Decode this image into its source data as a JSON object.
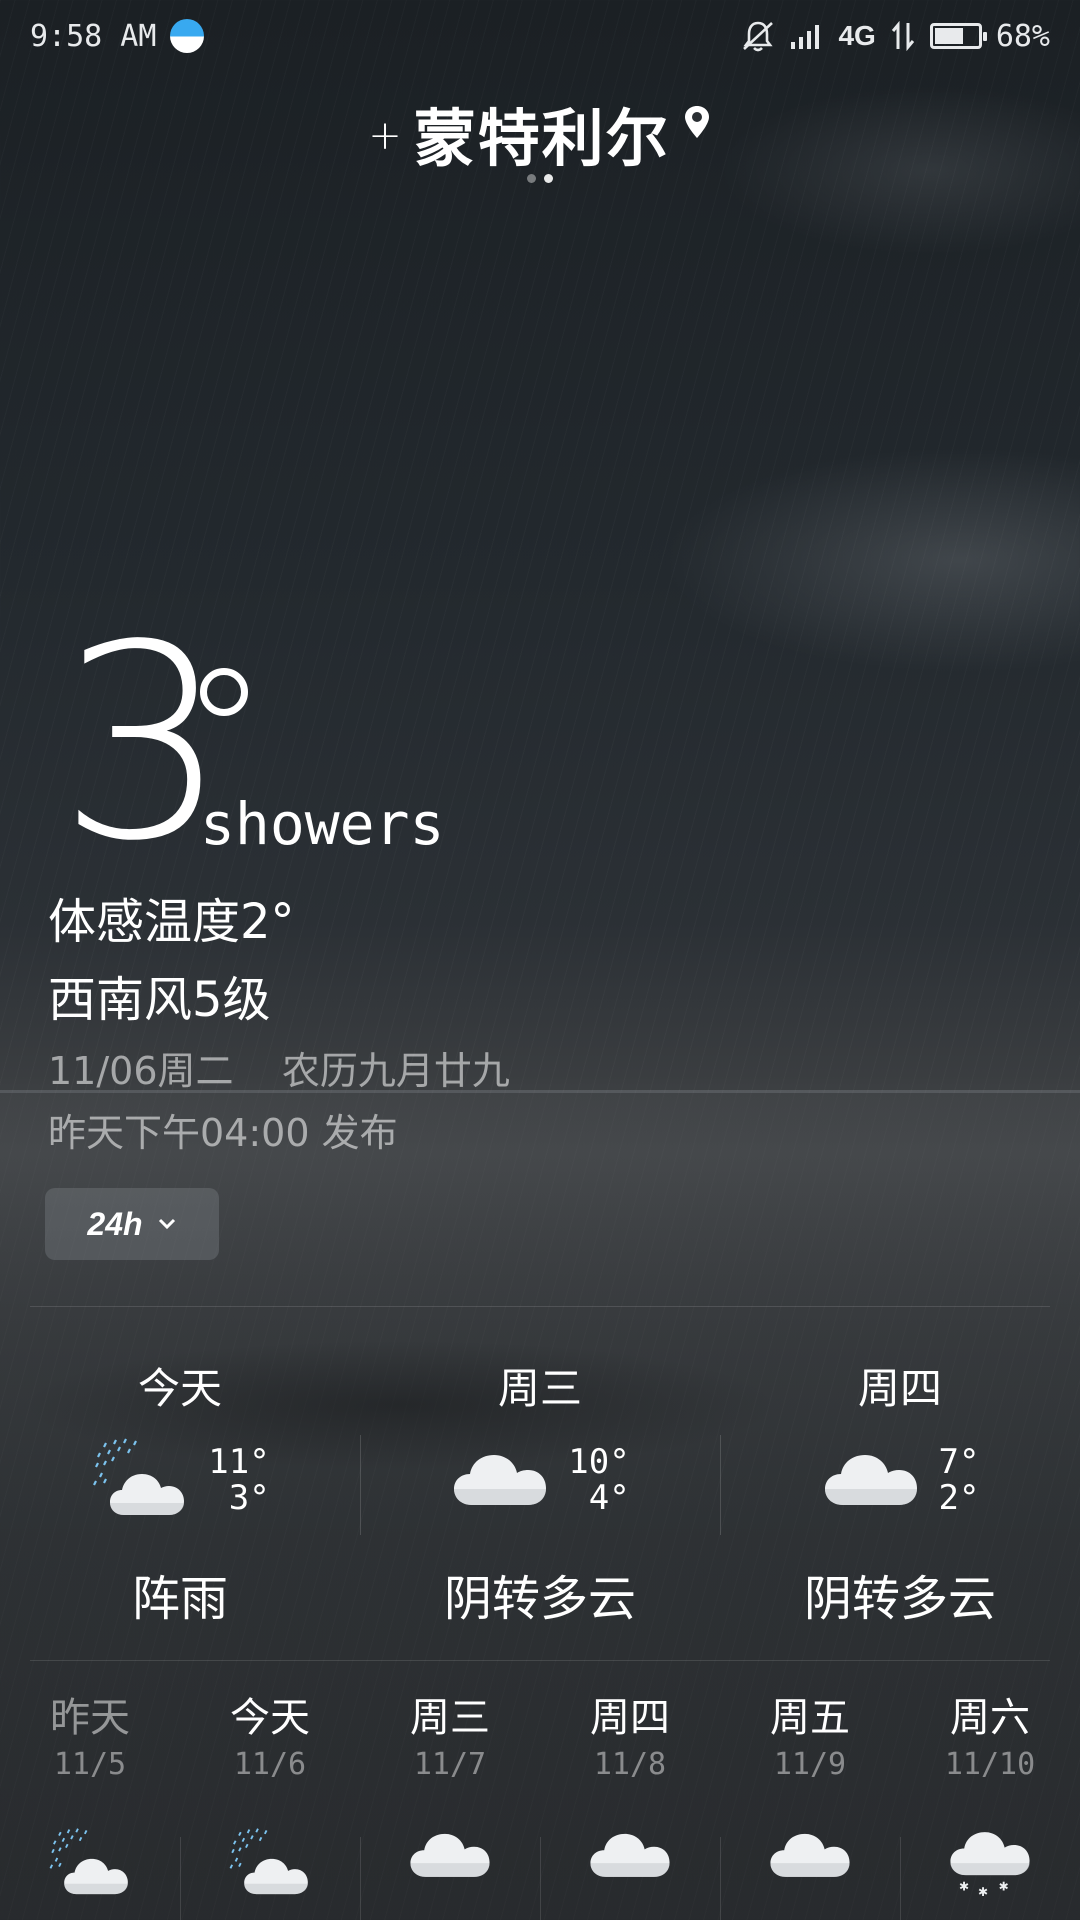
{
  "status_bar": {
    "time": "9:58 AM",
    "network": "4G",
    "battery_text": "68%",
    "battery_level": 0.68,
    "icons": [
      "weather-app-icon",
      "mute-bell-icon",
      "signal-icon",
      "data-transfer-icon",
      "battery-icon"
    ]
  },
  "header": {
    "add_symbol": "+",
    "city": "蒙特利尔",
    "page_count": 2,
    "active_page": 1
  },
  "current": {
    "temperature": "3",
    "condition": "showers",
    "feels_like": "体感温度2°",
    "wind": "西南风5级",
    "date": "11/06周二    农历九月廿九",
    "published": "昨天下午04:00 发布",
    "hourly_toggle": "24h"
  },
  "days": [
    {
      "name": "今天",
      "high": "11°",
      "low": "3°",
      "condition": "阵雨",
      "icon": "rain-cloud-icon"
    },
    {
      "name": "周三",
      "high": "10°",
      "low": "4°",
      "condition": "阴转多云",
      "icon": "cloud-icon"
    },
    {
      "name": "周四",
      "high": "7°",
      "low": "2°",
      "condition": "阴转多云",
      "icon": "cloud-icon"
    }
  ],
  "week": [
    {
      "name": "昨天",
      "date": "11/5",
      "icon": "rain-cloud-icon",
      "past": true
    },
    {
      "name": "今天",
      "date": "11/6",
      "icon": "rain-cloud-icon",
      "past": false
    },
    {
      "name": "周三",
      "date": "11/7",
      "icon": "cloud-icon",
      "past": false
    },
    {
      "name": "周四",
      "date": "11/8",
      "icon": "cloud-icon",
      "past": false
    },
    {
      "name": "周五",
      "date": "11/9",
      "icon": "cloud-icon",
      "past": false
    },
    {
      "name": "周六",
      "date": "11/10",
      "icon": "snow-cloud-icon",
      "past": false
    }
  ],
  "colors": {
    "rain_drops": "#7cc4f0",
    "cloud": "#eef0f2",
    "text": "#ffffff"
  }
}
